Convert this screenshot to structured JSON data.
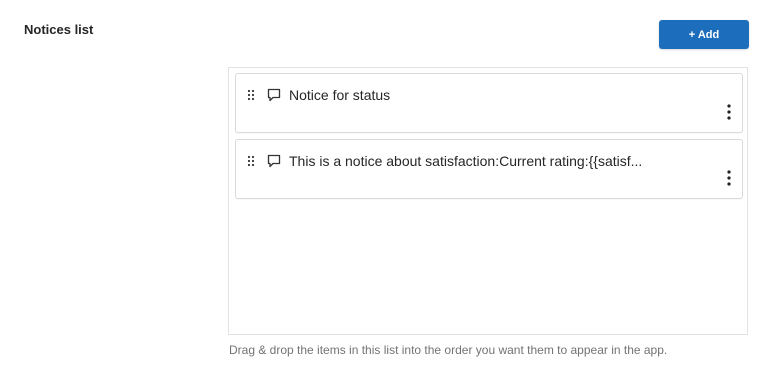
{
  "section": {
    "title": "Notices list"
  },
  "toolbar": {
    "add_label": "+ Add",
    "accent_color": "#1c6dbb"
  },
  "notices": [
    {
      "text": "Notice for status",
      "icon": "comment-icon"
    },
    {
      "text": "This is a notice about satisfaction:Current rating:{{satisf...",
      "icon": "comment-icon"
    }
  ],
  "helper": {
    "text": "Drag & drop the items in this list into the order you want them to appear in the app."
  }
}
